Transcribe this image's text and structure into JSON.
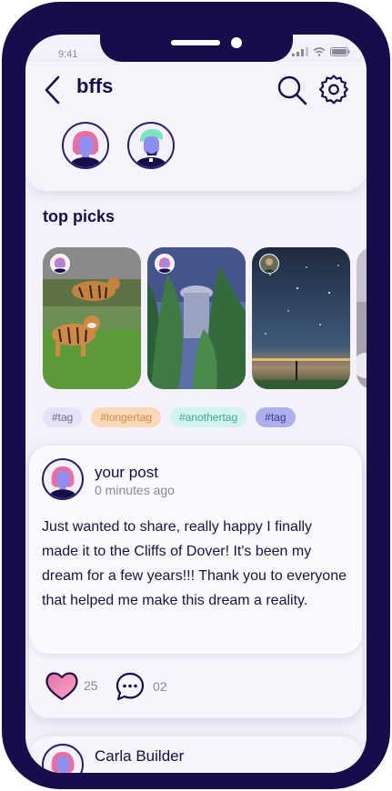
{
  "status_bar": {
    "time": "9:41"
  },
  "header": {
    "title": "bffs",
    "icons": [
      "back-arrow-icon",
      "search-icon",
      "gear-icon"
    ],
    "friends": [
      {
        "avatar": "pink-hair-avatar"
      },
      {
        "avatar": "green-hair-avatar"
      }
    ]
  },
  "top_picks": {
    "title": "top picks",
    "items": [
      {
        "image": "tigers-photo"
      },
      {
        "image": "tree-building-photo"
      },
      {
        "image": "starry-night-photo"
      },
      {
        "image": "partial-photo"
      }
    ]
  },
  "tags": [
    "#tag",
    "#longertag",
    "#anothertag",
    "#tag"
  ],
  "post": {
    "author": "your post",
    "time": "0 minutes ago",
    "body": "Just wanted to share, really happy I finally made it to the Cliffs of Dover! It's been my dream for a few years!!! Thank you to everyone that helped me make this dream a reality.",
    "likes": "25",
    "comments": "02"
  },
  "next_post": {
    "author": "Carla Builder"
  },
  "colors": {
    "frame": "#160d4a",
    "background": "#f4f1fa",
    "accent_pink": "#e86fa4",
    "text": "#1a1446"
  }
}
